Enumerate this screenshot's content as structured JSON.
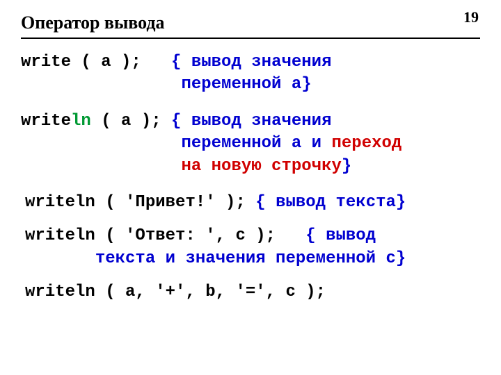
{
  "page_number": "19",
  "title": "Оператор вывода",
  "l1a": "write ( a );   ",
  "l1b": "{ вывод значения\n                переменной a}",
  "l2a": "write",
  "l2b": "ln",
  "l2c": " ( a ); ",
  "l2d": "{ вывод значения\n                переменной a и ",
  "l2e": "переход\n                на новую строчку",
  "l2f": "}",
  "l3a": "writeln ( 'Привет!' ); ",
  "l3b": "{ вывод текста}",
  "l4a": "writeln ( 'Ответ: ', c );   ",
  "l4b": "{ вывод\n       текста и значения переменной c}",
  "l5": "writeln ( a, '+', b, '=', c );"
}
